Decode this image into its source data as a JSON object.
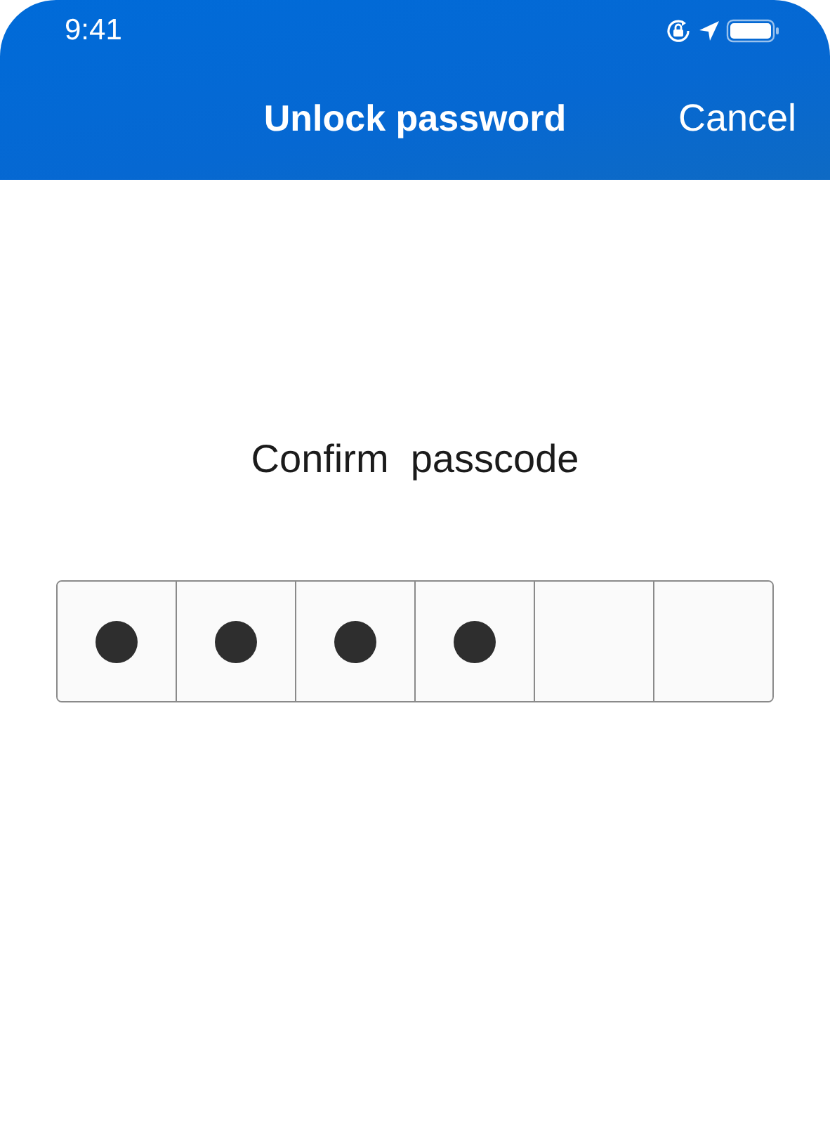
{
  "status_bar": {
    "time": "9:41"
  },
  "nav_bar": {
    "title": "Unlock password",
    "cancel": "Cancel"
  },
  "prompt": "Confirm  passcode",
  "passcode_cells": [
    {
      "filled": true
    },
    {
      "filled": true
    },
    {
      "filled": true
    },
    {
      "filled": true
    },
    {
      "filled": false
    },
    {
      "filled": false
    }
  ]
}
